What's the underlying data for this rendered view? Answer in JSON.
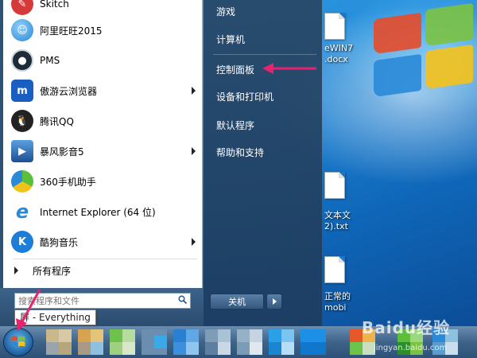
{
  "start_menu": {
    "programs": [
      {
        "label": "Skitch",
        "icon": "skitch-icon",
        "color": "#d43a3a"
      },
      {
        "label": "阿里旺旺2015",
        "icon": "aliwangwang-icon",
        "color": "#3a9ad9"
      },
      {
        "label": "PMS",
        "icon": "pms-icon",
        "color": "#1d2a38"
      },
      {
        "label": "傲游云浏览器",
        "icon": "maxthon-icon",
        "color": "#1b5ec2",
        "submenu": true
      },
      {
        "label": "腾讯QQ",
        "icon": "qq-icon",
        "color": "#222222"
      },
      {
        "label": "暴风影音5",
        "icon": "baofeng-icon",
        "color": "#2463a8",
        "submenu": true
      },
      {
        "label": "360手机助手",
        "icon": "360-assistant-icon",
        "color": "#5cbf3c"
      },
      {
        "label": "Internet Explorer (64 位)",
        "icon": "ie-icon",
        "color": "#2a8ad8"
      },
      {
        "label": "酷狗音乐",
        "icon": "kugou-icon",
        "color": "#1d7ed8",
        "submenu": true
      }
    ],
    "all_programs": "所有程序",
    "search_placeholder": "搜索程序和文件",
    "right_items": [
      "游戏",
      "计算机",
      "控制面板",
      "设备和打印机",
      "默认程序",
      "帮助和支持"
    ],
    "shutdown_label": "关机"
  },
  "tooltip": "屏 - Everything",
  "desktop": {
    "files": [
      {
        "line1": "eWIN7",
        "line2": ".docx"
      },
      {
        "line1": "文本文",
        "line2": "2).txt"
      },
      {
        "line1": "正常的",
        "line2": "mobi"
      }
    ]
  },
  "watermark": {
    "text": "Baidu经验",
    "sub": "jingyan.baidu.com"
  },
  "colors": {
    "annotation_arrow": "#e8236e",
    "right_pane": "#2a4a6e",
    "taskbar": "#3e6389"
  }
}
